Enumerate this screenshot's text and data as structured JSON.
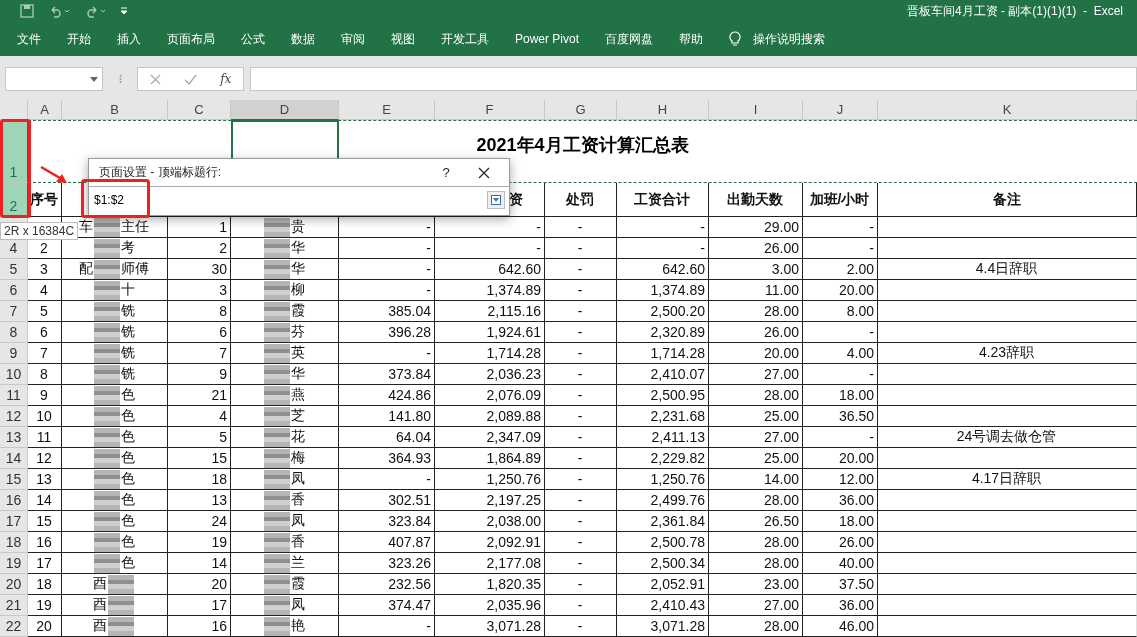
{
  "window": {
    "title": "晋板车间4月工资 - 副本(1)(1)(1)  -  Excel"
  },
  "ribbon_tabs": [
    "文件",
    "开始",
    "插入",
    "页面布局",
    "公式",
    "数据",
    "审阅",
    "视图",
    "开发工具",
    "Power Pivot",
    "百度网盘",
    "帮助"
  ],
  "tell_me": "操作说明搜索",
  "formula_bar": {
    "function_label": "fx"
  },
  "sheet": {
    "columns": [
      {
        "label": "A",
        "selected": false
      },
      {
        "label": "B",
        "selected": false
      },
      {
        "label": "C",
        "selected": false
      },
      {
        "label": "D",
        "selected": true
      },
      {
        "label": "E",
        "selected": false
      },
      {
        "label": "F",
        "selected": false
      },
      {
        "label": "G",
        "selected": false
      },
      {
        "label": "H",
        "selected": false
      },
      {
        "label": "I",
        "selected": false
      },
      {
        "label": "J",
        "selected": false
      },
      {
        "label": "K",
        "selected": false
      }
    ],
    "title_row": {
      "header": "1",
      "selected": true,
      "title": "2021年4月工资计算汇总表"
    },
    "header_row": {
      "header": "2",
      "selected": true,
      "cells": [
        "序号",
        null,
        null,
        null,
        null,
        "资",
        "处罚",
        "工资合计",
        "出勤天数",
        "加班/小时",
        "备注"
      ]
    },
    "rows": [
      {
        "cells": [
          null,
          [
            "车",
            "主任"
          ],
          "1",
          [
            null,
            "贵"
          ],
          "-",
          "-",
          "-",
          "-",
          "29.00",
          "-",
          null
        ]
      },
      {
        "header": "4",
        "cells": [
          "2",
          [
            null,
            "考"
          ],
          "2",
          [
            null,
            "华"
          ],
          "-",
          "-",
          "-",
          "-",
          "26.00",
          "-",
          null
        ]
      },
      {
        "header": "5",
        "cells": [
          "3",
          [
            "配",
            "师傅"
          ],
          "30",
          [
            null,
            "华"
          ],
          "-",
          "642.60",
          "-",
          "642.60",
          "3.00",
          "2.00",
          "4.4日辞职"
        ]
      },
      {
        "header": "6",
        "cells": [
          "4",
          [
            null,
            "十"
          ],
          "3",
          [
            null,
            "柳"
          ],
          "-",
          "1,374.89",
          "-",
          "1,374.89",
          "11.00",
          "20.00",
          null
        ]
      },
      {
        "header": "7",
        "cells": [
          "5",
          [
            null,
            "铣"
          ],
          "8",
          [
            null,
            "霞"
          ],
          "385.04",
          "2,115.16",
          "-",
          "2,500.20",
          "28.00",
          "8.00",
          null
        ]
      },
      {
        "header": "8",
        "cells": [
          "6",
          [
            null,
            "铣"
          ],
          "6",
          [
            null,
            "芬"
          ],
          "396.28",
          "1,924.61",
          "-",
          "2,320.89",
          "26.00",
          "-",
          null
        ]
      },
      {
        "header": "9",
        "cells": [
          "7",
          [
            null,
            "铣"
          ],
          "7",
          [
            null,
            "英"
          ],
          "-",
          "1,714.28",
          "-",
          "1,714.28",
          "20.00",
          "4.00",
          "4.23辞职"
        ]
      },
      {
        "header": "10",
        "cells": [
          "8",
          [
            null,
            "铣"
          ],
          "9",
          [
            null,
            "华"
          ],
          "373.84",
          "2,036.23",
          "-",
          "2,410.07",
          "27.00",
          "-",
          null
        ]
      },
      {
        "header": "11",
        "cells": [
          "9",
          [
            null,
            "色"
          ],
          "21",
          [
            null,
            "燕"
          ],
          "424.86",
          "2,076.09",
          "-",
          "2,500.95",
          "28.00",
          "18.00",
          null
        ]
      },
      {
        "header": "12",
        "cells": [
          "10",
          [
            null,
            "色"
          ],
          "4",
          [
            null,
            "芝"
          ],
          "141.80",
          "2,089.88",
          "-",
          "2,231.68",
          "25.00",
          "36.50",
          null
        ]
      },
      {
        "header": "13",
        "cells": [
          "11",
          [
            null,
            "色"
          ],
          "5",
          [
            null,
            "花"
          ],
          "64.04",
          "2,347.09",
          "-",
          "2,411.13",
          "27.00",
          "-",
          "24号调去做仓管"
        ]
      },
      {
        "header": "14",
        "cells": [
          "12",
          [
            null,
            "色"
          ],
          "15",
          [
            null,
            "梅"
          ],
          "364.93",
          "1,864.89",
          "-",
          "2,229.82",
          "25.00",
          "20.00",
          null
        ]
      },
      {
        "header": "15",
        "cells": [
          "13",
          [
            null,
            "色"
          ],
          "18",
          [
            null,
            "凤"
          ],
          "-",
          "1,250.76",
          "-",
          "1,250.76",
          "14.00",
          "12.00",
          "4.17日辞职"
        ]
      },
      {
        "header": "16",
        "cells": [
          "14",
          [
            null,
            "色"
          ],
          "13",
          [
            null,
            "香"
          ],
          "302.51",
          "2,197.25",
          "-",
          "2,499.76",
          "28.00",
          "36.00",
          null
        ]
      },
      {
        "header": "17",
        "cells": [
          "15",
          [
            null,
            "色"
          ],
          "24",
          [
            null,
            "凤"
          ],
          "323.84",
          "2,038.00",
          "-",
          "2,361.84",
          "26.50",
          "18.00",
          null
        ]
      },
      {
        "header": "18",
        "cells": [
          "16",
          [
            null,
            "色"
          ],
          "19",
          [
            null,
            "香"
          ],
          "407.87",
          "2,092.91",
          "-",
          "2,500.78",
          "28.00",
          "26.00",
          null
        ]
      },
      {
        "header": "19",
        "cells": [
          "17",
          [
            null,
            "色"
          ],
          "14",
          [
            null,
            "兰"
          ],
          "323.26",
          "2,177.08",
          "-",
          "2,500.34",
          "28.00",
          "40.00",
          null
        ]
      },
      {
        "header": "20",
        "cells": [
          "18",
          [
            "酉",
            null
          ],
          "20",
          [
            null,
            "霞"
          ],
          "232.56",
          "1,820.35",
          "-",
          "2,052.91",
          "23.00",
          "37.50",
          null
        ]
      },
      {
        "header": "21",
        "cells": [
          "19",
          [
            "酉",
            null
          ],
          "17",
          [
            null,
            "凤"
          ],
          "374.47",
          "2,035.96",
          "-",
          "2,410.43",
          "27.00",
          "36.00",
          null
        ]
      },
      {
        "header": "22",
        "cells": [
          "20",
          [
            "酉",
            null
          ],
          "16",
          [
            null,
            "艳"
          ],
          "-",
          "3,071.28",
          "-",
          "3,071.28",
          "28.00",
          "46.00",
          null
        ]
      }
    ]
  },
  "dialog": {
    "title": "页面设置 - 顶端标题行:",
    "help": "?",
    "value": "$1:$2"
  },
  "tooltip": "2R x 16384C"
}
